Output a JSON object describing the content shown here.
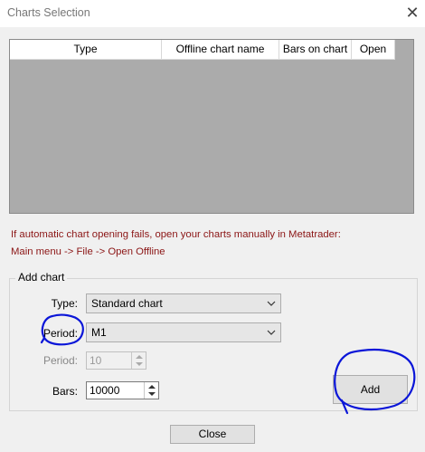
{
  "window": {
    "title": "Charts Selection"
  },
  "table": {
    "columns": [
      "Type",
      "Offline chart name",
      "Bars on chart",
      "Open"
    ],
    "rows": []
  },
  "notice": {
    "line1": "If automatic chart opening fails, open your charts manually in Metatrader:",
    "line2": "Main menu -> File -> Open Offline"
  },
  "add_chart": {
    "group_label": "Add chart",
    "type_label": "Type:",
    "type_value": "Standard chart",
    "period_label": "Period:",
    "period_value": "M1",
    "period2_label": "Period:",
    "period2_value": "10",
    "bars_label": "Bars:",
    "bars_value": "10000",
    "add_label": "Add"
  },
  "footer": {
    "close_label": "Close"
  },
  "colors": {
    "notice": "#8b1515",
    "annotation": "#0b16d8",
    "table_bg": "#ababab"
  }
}
